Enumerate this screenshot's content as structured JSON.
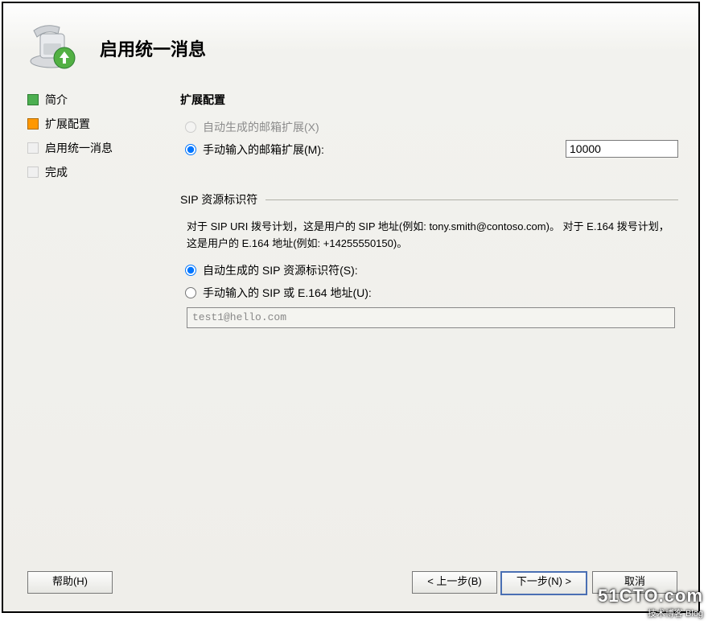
{
  "header": {
    "title": "启用统一消息"
  },
  "sidebar": {
    "steps": [
      {
        "label": "简介",
        "state": "green"
      },
      {
        "label": "扩展配置",
        "state": "orange"
      },
      {
        "label": "启用统一消息",
        "state": "grey"
      },
      {
        "label": "完成",
        "state": "grey"
      }
    ]
  },
  "main": {
    "section_title": "扩展配置",
    "auto_ext_label": "自动生成的邮箱扩展(X)",
    "manual_ext_label": "手动输入的邮箱扩展(M):",
    "manual_ext_value": "10000",
    "sip_group_title": "SIP 资源标识符",
    "sip_desc": "对于 SIP URI 拨号计划，这是用户的 SIP 地址(例如: tony.smith@contoso.com)。 对于 E.164 拨号计划，这是用户的 E.164 地址(例如: +14255550150)。",
    "auto_sip_label": "自动生成的 SIP 资源标识符(S):",
    "manual_sip_label": "手动输入的 SIP 或 E.164 地址(U):",
    "sip_value": "test1@hello.com"
  },
  "footer": {
    "help": "帮助(H)",
    "back": "< 上一步(B)",
    "next": "下一步(N) >",
    "cancel": "取消"
  },
  "watermark": {
    "big": "51CTO.com",
    "small": "技术博客  Blog"
  }
}
